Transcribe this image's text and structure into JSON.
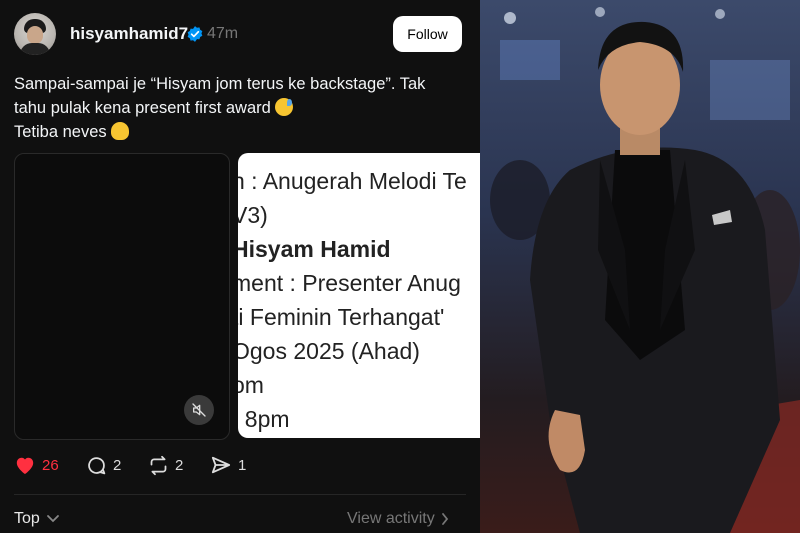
{
  "post": {
    "username": "hisyamhamid7",
    "time": "47m",
    "follow_label": "Follow",
    "caption": {
      "line1": "Sampai-sampai je “Hisyam jom terus ke backstage”. Tak",
      "line2": "tahu pulak kena present first award",
      "line3": "Tetiba neves"
    }
  },
  "media": {
    "document_lines": [
      "n : Anugerah Melodi Te",
      "V3)",
      "Hisyam Hamid",
      "ment : Presenter Anug",
      "ti Feminin Terhangat'",
      " Ogos 2025 (Ahad)",
      "om",
      " : 8pm"
    ],
    "mute_icon": "speaker-muted-icon"
  },
  "actions": {
    "likes": "26",
    "comments": "2",
    "reposts": "2",
    "shares": "1"
  },
  "footer": {
    "sort_label": "Top",
    "activity_label": "View activity"
  },
  "colors": {
    "background": "#101010",
    "like_red": "#ff3040",
    "verified_blue": "#0095f6",
    "muted_text": "#777777"
  }
}
